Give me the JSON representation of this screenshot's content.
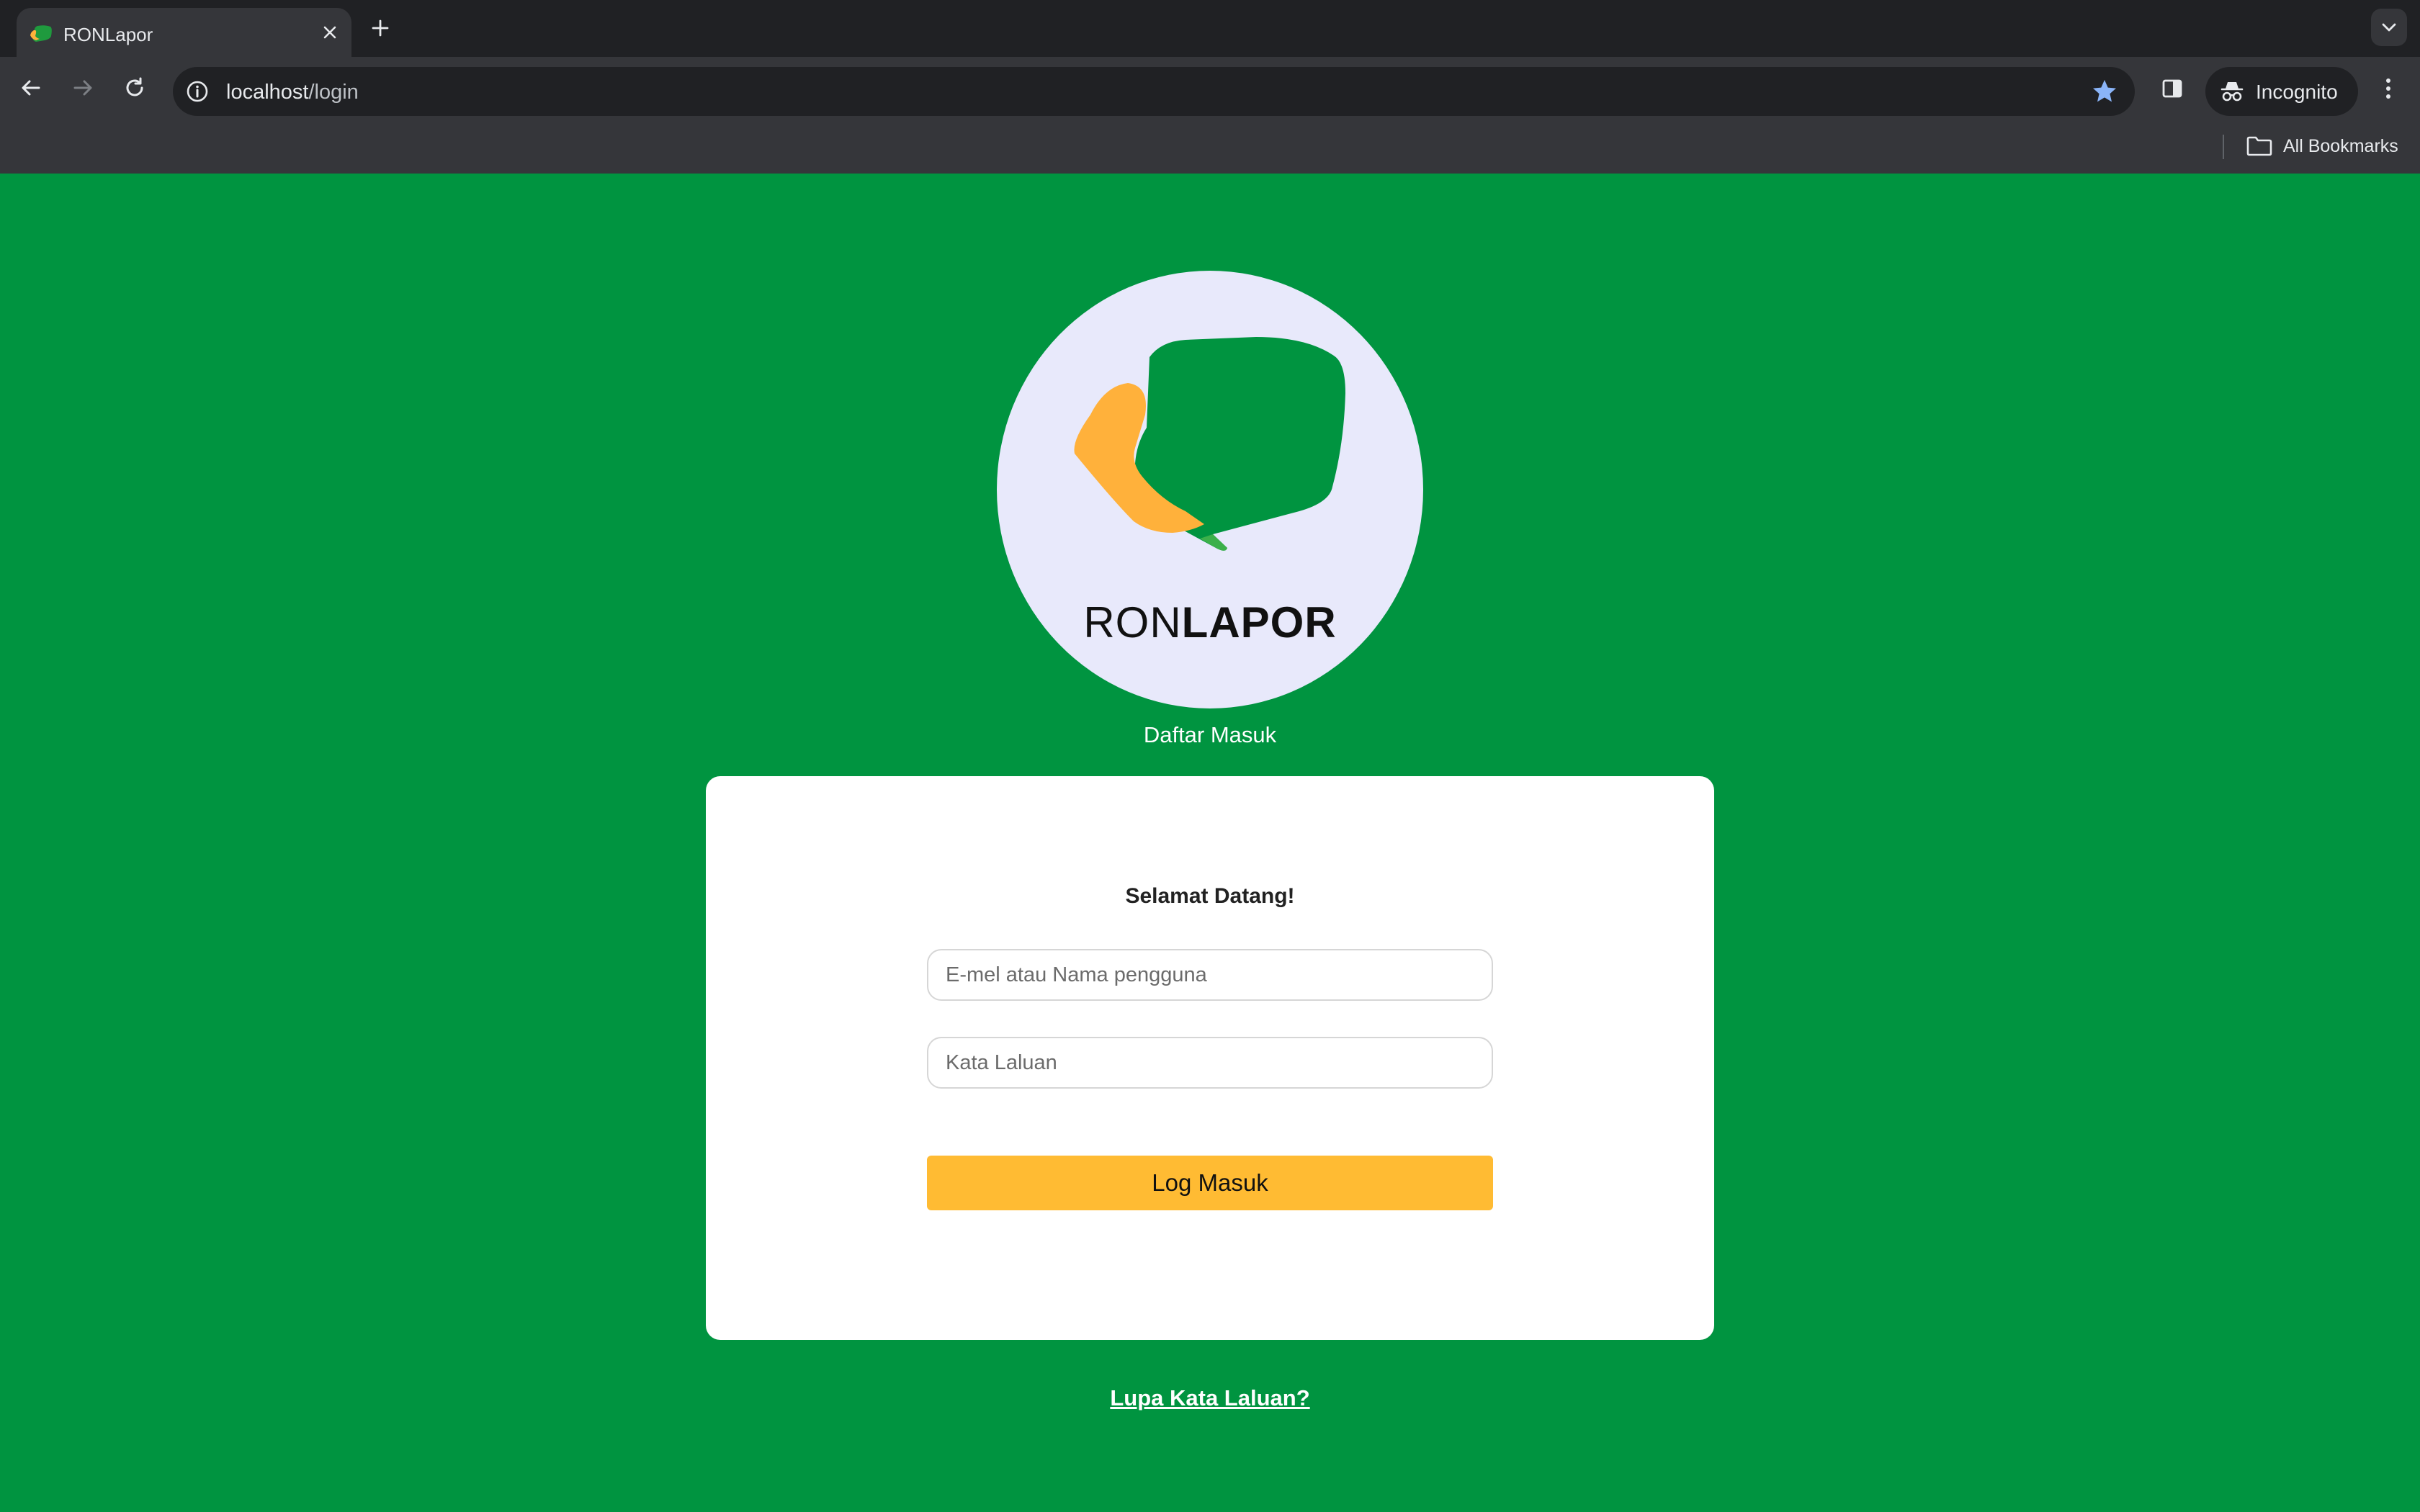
{
  "browser": {
    "tab": {
      "title": "RONLapor"
    },
    "address": {
      "host": "localhost",
      "path": "/login"
    },
    "profile_label": "Incognito",
    "bookmarks_label": "All Bookmarks",
    "colors": {
      "star": "#8ab4f8"
    }
  },
  "page": {
    "logo": {
      "word_light": "RON",
      "word_bold": "LAPOR"
    },
    "subtitle": "Daftar Masuk",
    "card": {
      "title": "Selamat Datang!",
      "email_placeholder": "E-mel atau Nama pengguna",
      "password_placeholder": "Kata Laluan",
      "submit_label": "Log Masuk"
    },
    "forgot_link": "Lupa Kata Laluan?",
    "colors": {
      "background": "#009440",
      "button": "#ffbb33",
      "logo_green": "#009440",
      "logo_orange": "#ffb13b"
    }
  }
}
